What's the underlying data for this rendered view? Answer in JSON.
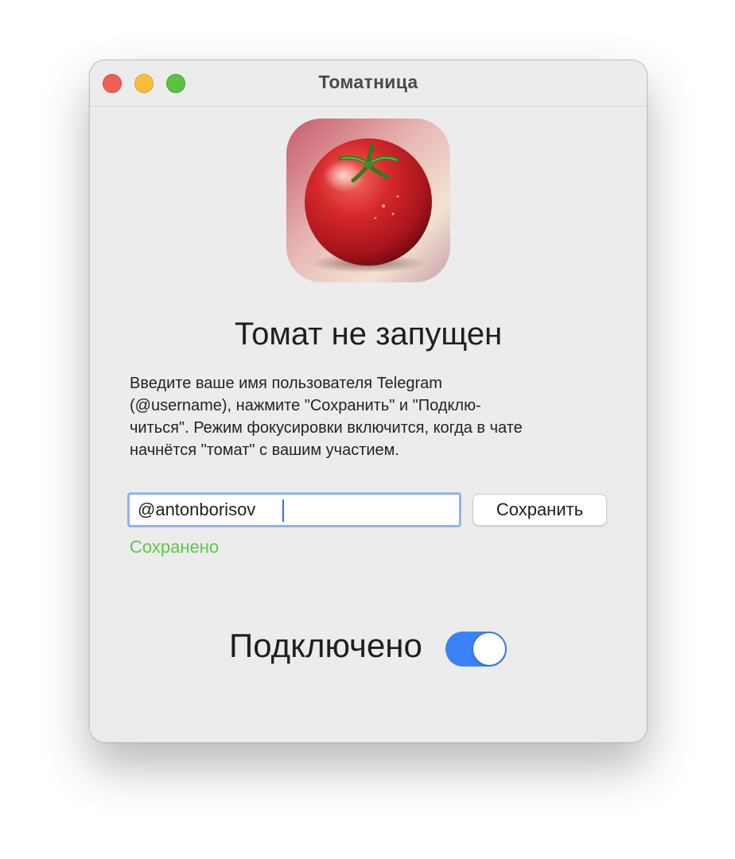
{
  "window": {
    "title": "Томатница"
  },
  "app_icon": {
    "icon": "tomato-icon"
  },
  "status": {
    "title": "Томат не запущен"
  },
  "description": {
    "text": "Введите ваше имя пользователя Telegram\n(@username), нажмите \"Сохранить\" и \"Подклю-\nчиться\". Режим фокусировки включится, когда в чате\nначнётся \"томат\" с вашим участием."
  },
  "username_field": {
    "value": "@antonborisov"
  },
  "save_button": {
    "label": "Сохранить"
  },
  "save_status": {
    "text": "Сохранено",
    "color": "#5cc84a"
  },
  "connection": {
    "label": "Подключено",
    "enabled": true,
    "accent": "#3b82f6"
  }
}
